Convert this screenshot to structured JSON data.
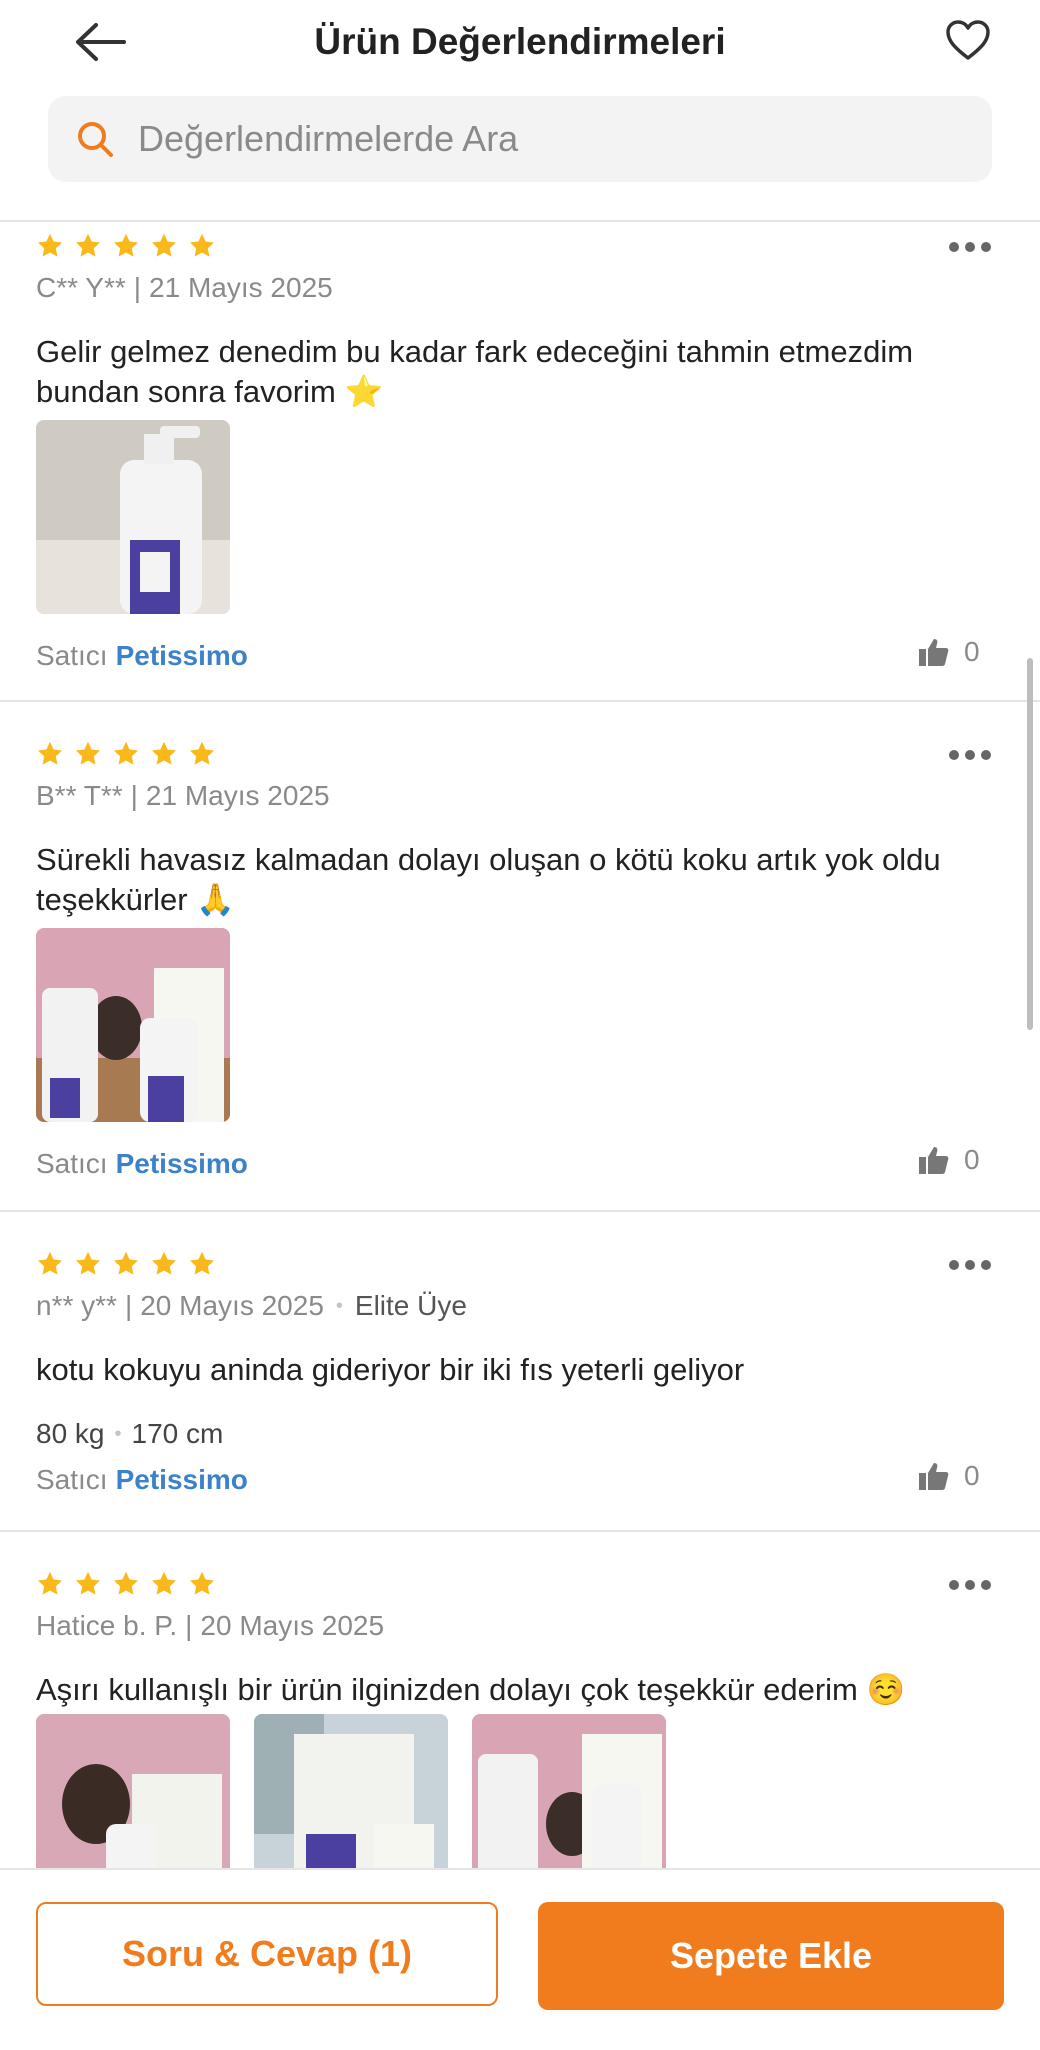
{
  "header": {
    "title": "Ürün Değerlendirmeleri",
    "search_placeholder": "Değerlendirmelerde Ara"
  },
  "colors": {
    "accent": "#f07c1d",
    "star": "#f9b91b",
    "link": "#3b82c9"
  },
  "icons": {
    "back": "arrow-left-icon",
    "favorite": "heart-icon",
    "search": "search-icon",
    "more": "more-dots-icon",
    "like": "thumbs-up-icon"
  },
  "reviews": [
    {
      "rating": 5,
      "author": "C** Y**",
      "date": "21 Mayıs 2025",
      "text": "Gelir gelmez denedim bu kadar fark edeceğini tahmin etmezdim bundan sonra favorim ⭐️",
      "photos": 1,
      "seller_label": "Satıcı",
      "seller_name": "Petissimo",
      "likes": "0"
    },
    {
      "rating": 5,
      "author": "B** T**",
      "date": "21 Mayıs 2025",
      "text": "Sürekli havasız kalmadan dolayı oluşan o kötü koku artık yok oldu teşekkürler 🙏",
      "photos": 1,
      "seller_label": "Satıcı",
      "seller_name": "Petissimo",
      "likes": "0"
    },
    {
      "rating": 5,
      "author": "n** y**",
      "date": "20 Mayıs 2025",
      "badge": "Elite Üye",
      "text": "kotu kokuyu aninda gideriyor  bir iki fıs yeterli geliyor",
      "weight": "80 kg",
      "height": "170 cm",
      "seller_label": "Satıcı",
      "seller_name": "Petissimo",
      "likes": "0"
    },
    {
      "rating": 5,
      "author": "Hatice b. P.",
      "date": "20 Mayıs 2025",
      "text": "Aşırı kullanışlı bir ürün ilginizden dolayı çok teşekkür ederim ☺️",
      "photos": 3
    }
  ],
  "bottom": {
    "qa_label": "Soru & Cevap (1)",
    "cart_label": "Sepete Ekle"
  }
}
